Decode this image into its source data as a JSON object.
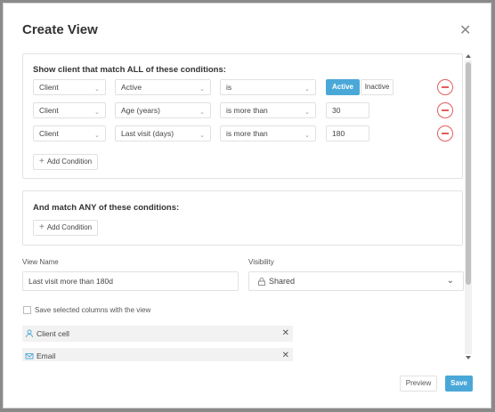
{
  "dialog": {
    "title": "Create View"
  },
  "all_conditions": {
    "heading": "Show client that match ALL of these conditions:",
    "rows": [
      {
        "entity": "Client",
        "field": "Active",
        "operator": "is",
        "active_label": "Active",
        "inactive_label": "Inactive"
      },
      {
        "entity": "Client",
        "field": "Age (years)",
        "operator": "is more than",
        "value": "30"
      },
      {
        "entity": "Client",
        "field": "Last visit (days)",
        "operator": "is more than",
        "value": "180"
      }
    ],
    "add_label": "Add Condition"
  },
  "any_conditions": {
    "heading": "And match ANY of these conditions:",
    "add_label": "Add Condition"
  },
  "view_name": {
    "label": "View Name",
    "value": "Last visit more than 180d"
  },
  "visibility": {
    "label": "Visibility",
    "value": "Shared"
  },
  "save_columns_label": "Save selected columns with the view",
  "columns": [
    {
      "label": "Client cell",
      "icon": "person-icon"
    },
    {
      "label": "Email",
      "icon": "envelope-icon"
    }
  ],
  "footer": {
    "preview": "Preview",
    "save": "Save"
  },
  "colors": {
    "accent": "#4aa8d8",
    "danger": "#e45c5c"
  }
}
